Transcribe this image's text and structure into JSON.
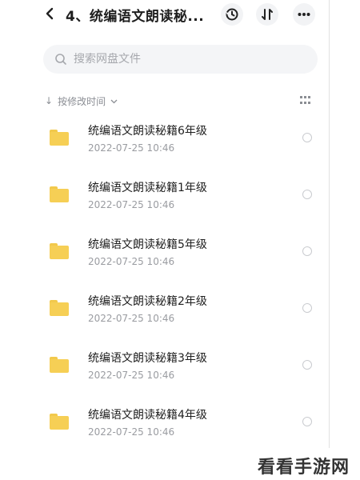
{
  "header": {
    "title": "4、统编语文朗读秘...",
    "back_icon": "chevron-left-icon",
    "history_icon": "history-icon",
    "sort_icon": "sort-icon",
    "more_icon": "more-horizontal-icon"
  },
  "search": {
    "placeholder": "搜索网盘文件",
    "value": ""
  },
  "sort": {
    "label": "按修改时间",
    "arrow": "↓",
    "chevron": "⌄"
  },
  "files": [
    {
      "name": "统编语文朗读秘籍6年级",
      "date": "2022-07-25  10:46"
    },
    {
      "name": "统编语文朗读秘籍1年级",
      "date": "2022-07-25  10:46"
    },
    {
      "name": "统编语文朗读秘籍5年级",
      "date": "2022-07-25  10:46"
    },
    {
      "name": "统编语文朗读秘籍2年级",
      "date": "2022-07-25  10:46"
    },
    {
      "name": "统编语文朗读秘籍3年级",
      "date": "2022-07-25  10:46"
    },
    {
      "name": "统编语文朗读秘籍4年级",
      "date": "2022-07-25  10:46"
    }
  ],
  "watermark": "看看手游网",
  "colors": {
    "folder": "#f6cf55",
    "accent_gray": "#8b8e94",
    "search_bg": "#f4f5f7"
  }
}
